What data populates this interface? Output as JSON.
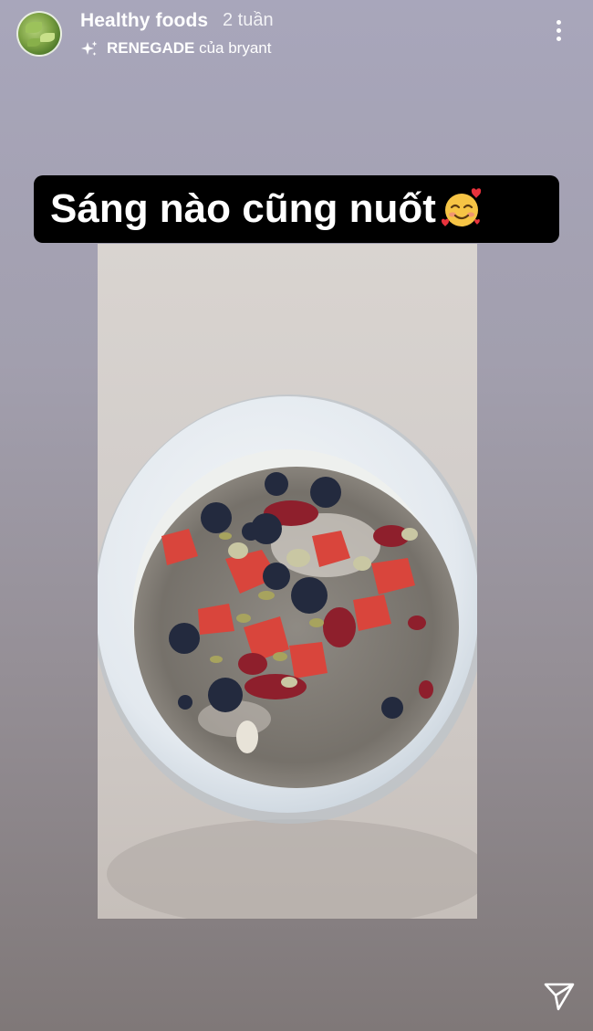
{
  "header": {
    "username": "Healthy foods",
    "time": "2 tuần",
    "music_title": "RENEGADE",
    "music_suffix": " của bryant"
  },
  "icons": {
    "avatar": "profile-avatar",
    "sparkle": "sparkle-icon",
    "more": "more-vertical-icon",
    "send": "send-icon",
    "emoji": "smiling-face-with-hearts-emoji"
  },
  "caption": {
    "text": "Sáng nào cũng nuốt"
  },
  "colors": {
    "caption_bg": "#000000",
    "text": "#ffffff"
  }
}
